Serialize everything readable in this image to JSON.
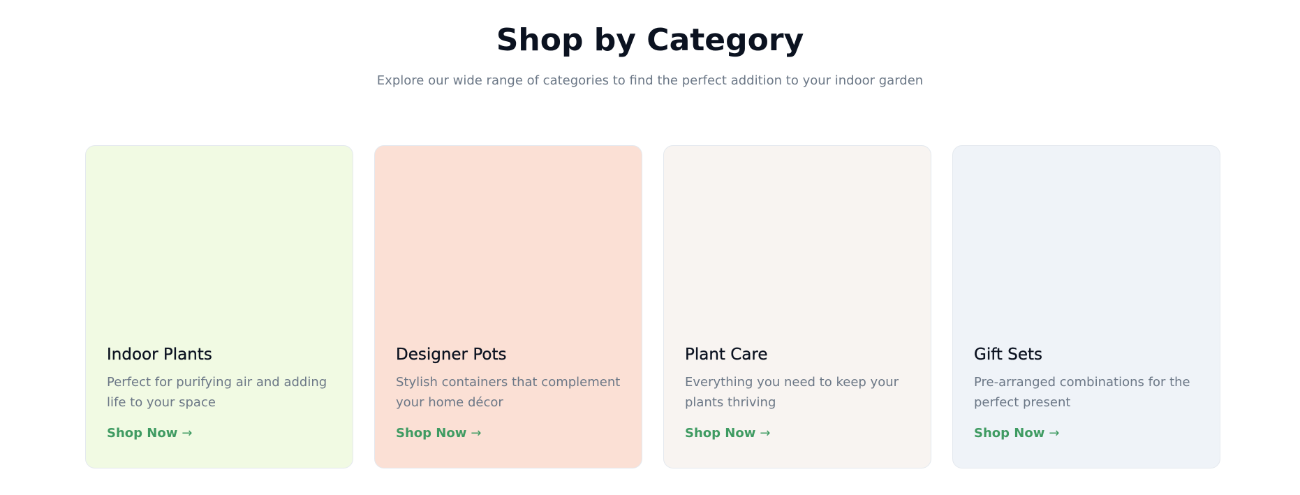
{
  "header": {
    "title": "Shop by Category",
    "subtitle": "Explore our wide range of categories to find the perfect addition to your indoor garden"
  },
  "categories": [
    {
      "title": "Indoor Plants",
      "description": "Perfect for purifying air and adding life to your space",
      "link_label": "Shop Now",
      "arrow_icon": "→",
      "background": "#f1fae3"
    },
    {
      "title": "Designer Pots",
      "description": "Stylish containers that complement your home décor",
      "link_label": "Shop Now",
      "arrow_icon": "→",
      "background": "#fbe0d5"
    },
    {
      "title": "Plant Care",
      "description": "Everything you need to keep your plants thriving",
      "link_label": "Shop Now",
      "arrow_icon": "→",
      "background": "#f8f4f1"
    },
    {
      "title": "Gift Sets",
      "description": "Pre-arranged combinations for the perfect present",
      "link_label": "Shop Now",
      "arrow_icon": "→",
      "background": "#eff3f8"
    }
  ],
  "colors": {
    "link": "#3f9b62",
    "title": "#0b1220",
    "muted": "#6b7786"
  }
}
